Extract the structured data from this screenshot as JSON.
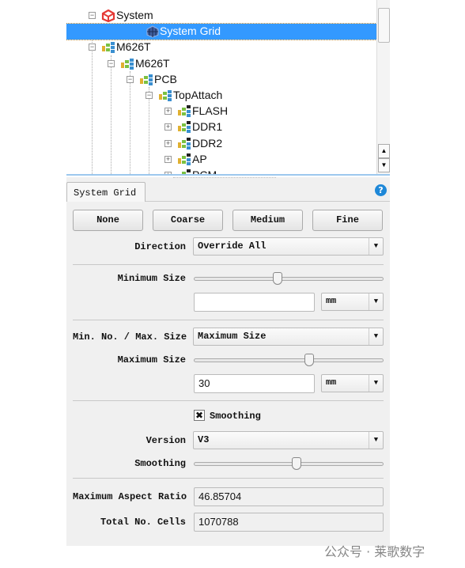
{
  "tree": {
    "items": [
      {
        "label": "System",
        "level": 0,
        "toggle": "minus",
        "icon": "system-cube-icon"
      },
      {
        "label": "System Grid",
        "level": 1,
        "toggle": "none",
        "icon": "grid-icon",
        "selected": true
      },
      {
        "label": "M626T",
        "level": 0,
        "toggle": "minus",
        "icon": "assembly-icon"
      },
      {
        "label": "M626T",
        "level": 1,
        "toggle": "minus",
        "icon": "assembly-icon"
      },
      {
        "label": "PCB",
        "level": 2,
        "toggle": "minus",
        "icon": "assembly-icon"
      },
      {
        "label": "TopAttach",
        "level": 3,
        "toggle": "minus",
        "icon": "assembly-icon"
      },
      {
        "label": "FLASH",
        "level": 4,
        "toggle": "plus",
        "icon": "gridded-assembly-icon"
      },
      {
        "label": "DDR1",
        "level": 4,
        "toggle": "plus",
        "icon": "gridded-assembly-icon"
      },
      {
        "label": "DDR2",
        "level": 4,
        "toggle": "plus",
        "icon": "gridded-assembly-icon"
      },
      {
        "label": " AP",
        "level": 4,
        "toggle": "plus",
        "icon": "gridded-assembly-icon"
      },
      {
        "label": "PCM",
        "level": 4,
        "toggle": "plus",
        "icon": "gridded-assembly-icon"
      }
    ],
    "colors": {
      "selection": "#3399ff",
      "system_icon": "#e53935"
    }
  },
  "panel": {
    "tab_label": "System Grid",
    "help_icon": "help-icon",
    "presets": [
      "None",
      "Coarse",
      "Medium",
      "Fine"
    ],
    "direction": {
      "label": "Direction",
      "value": "Override All"
    },
    "minimum_size": {
      "label": "Minimum Size",
      "slider_fraction": 0.44,
      "value": "",
      "unit": "mm"
    },
    "min_no_max_size": {
      "label": "Min. No. / Max. Size",
      "value": "Maximum Size"
    },
    "maximum_size": {
      "label": "Maximum Size",
      "slider_fraction": 0.61,
      "value": "30",
      "unit": "mm"
    },
    "smoothing_checkbox": {
      "label": "Smoothing",
      "checked": true
    },
    "version": {
      "label": "Version",
      "value": "V3"
    },
    "smoothing_slider": {
      "label": "Smoothing",
      "slider_fraction": 0.54
    },
    "max_aspect_ratio": {
      "label": "Maximum Aspect Ratio",
      "value": "46.85704"
    },
    "total_cells": {
      "label": "Total No. Cells",
      "value": "1070788"
    }
  },
  "watermark": "公众号 · 莱歌数字"
}
